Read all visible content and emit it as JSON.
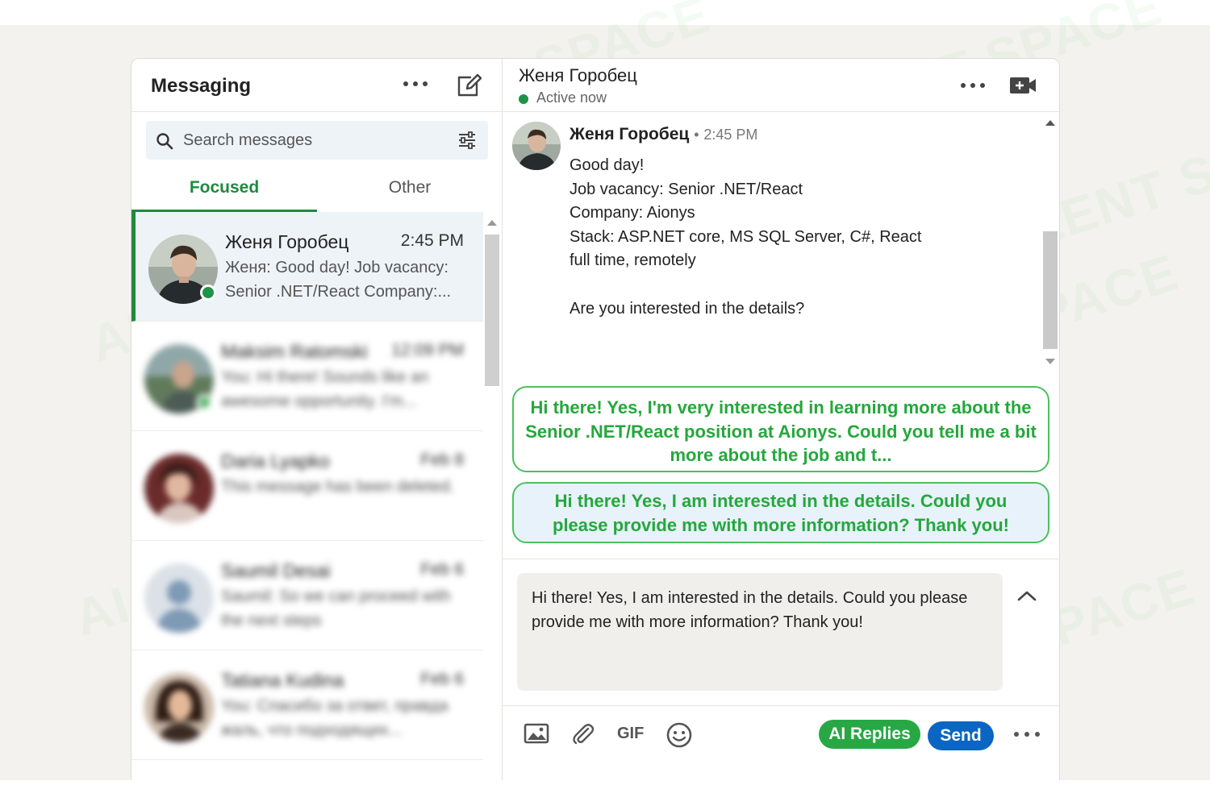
{
  "watermark_text": "AI TALENT SPACE",
  "messaging": {
    "title": "Messaging",
    "search_placeholder": "Search messages",
    "tabs": [
      {
        "label": "Focused",
        "active": true
      },
      {
        "label": "Other",
        "active": false
      }
    ],
    "conversations": [
      {
        "name": "Женя Горобец",
        "time": "2:45 PM",
        "preview": "Женя: Good day! Job vacancy: Senior .NET/React Company:...",
        "online": true,
        "active": true
      },
      {
        "name": "Maksim Ratomski",
        "time": "12:09 PM",
        "preview": "You: Hi there! Sounds like an awesome opportunity. I'm...",
        "online": true,
        "active": false
      },
      {
        "name": "Daria Lyapko",
        "time": "Feb 8",
        "preview": "This message has been deleted.",
        "online": false,
        "active": false
      },
      {
        "name": "Saumil Desai",
        "time": "Feb 6",
        "preview": "Saumil: So we can proceed with the next steps",
        "online": false,
        "active": false
      },
      {
        "name": "Tatiana Kudina",
        "time": "Feb 6",
        "preview": "You: Спасибо за ответ, правда жаль, что подходящих...",
        "online": false,
        "active": false
      }
    ]
  },
  "chat": {
    "contact_name": "Женя Горобец",
    "status": "Active now",
    "message": {
      "sender": "Женя Горобец",
      "separator": "•",
      "time": "2:45 PM",
      "lines": [
        "Good day!",
        "Job vacancy: Senior .NET/React",
        "Company: Aionys",
        "Stack: ASP.NET core, MS SQL Server, C#, React",
        "full time, remotely",
        "",
        "Are you interested in the details?"
      ]
    },
    "suggestions": [
      "Hi there! Yes, I'm very interested in learning more about the Senior .NET/React position at Aionys. Could you tell me a bit more about the job and t...",
      "Hi there! Yes, I am interested in the details. Could you please provide me with more information? Thank you!"
    ],
    "draft": "Hi there! Yes, I am interested in the details. Could you please provide me with more information? Thank you!",
    "toolbar": {
      "gif_label": "GIF",
      "ai_replies_label": "AI Replies",
      "send_label": "Send"
    }
  },
  "colors": {
    "accent_green": "#1e8a3e",
    "suggestion_green": "#24a83c",
    "send_blue": "#0a66c2",
    "online_green": "#1f9347"
  },
  "icons": [
    "compose-icon",
    "search-icon",
    "filter-icon",
    "video-call-icon",
    "image-icon",
    "attachment-icon",
    "emoji-icon",
    "chevron-up-icon",
    "more-icon"
  ]
}
